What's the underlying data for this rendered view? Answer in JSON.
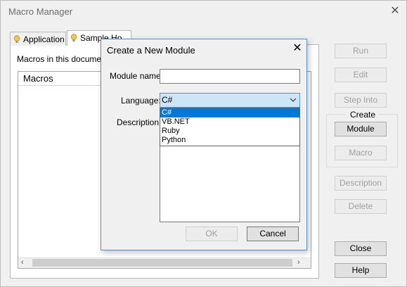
{
  "main": {
    "title": "Macro Manager",
    "close_glyph": "✕",
    "tabs": [
      {
        "label": "Application",
        "icon": "lightbulb-icon"
      },
      {
        "label": "Sample Ho",
        "icon": "lightbulb-icon"
      }
    ],
    "macros_in_document_label": "Macros in this document",
    "macros_column_header": "Macros",
    "scroll_left_glyph": "‹",
    "scroll_right_glyph": "›"
  },
  "buttons": {
    "run": "Run",
    "edit": "Edit",
    "step_into": "Step Into",
    "create_group": "Create",
    "module": "Module",
    "macro": "Macro",
    "description": "Description",
    "delete": "Delete",
    "close": "Close",
    "help": "Help"
  },
  "dialog": {
    "title": "Create a New Module",
    "close_glyph": "✕",
    "module_name_label": "Module name:",
    "module_name_value": "",
    "language_label": "Language:",
    "language_selected": "C#",
    "language_options": [
      "C#",
      "VB.NET",
      "Ruby",
      "Python"
    ],
    "description_label": "Description:",
    "ok": "OK",
    "cancel": "Cancel"
  },
  "colors": {
    "accent": "#0078d7",
    "dialog_border": "#5b8fc7",
    "bulb": "#f2c94c"
  }
}
